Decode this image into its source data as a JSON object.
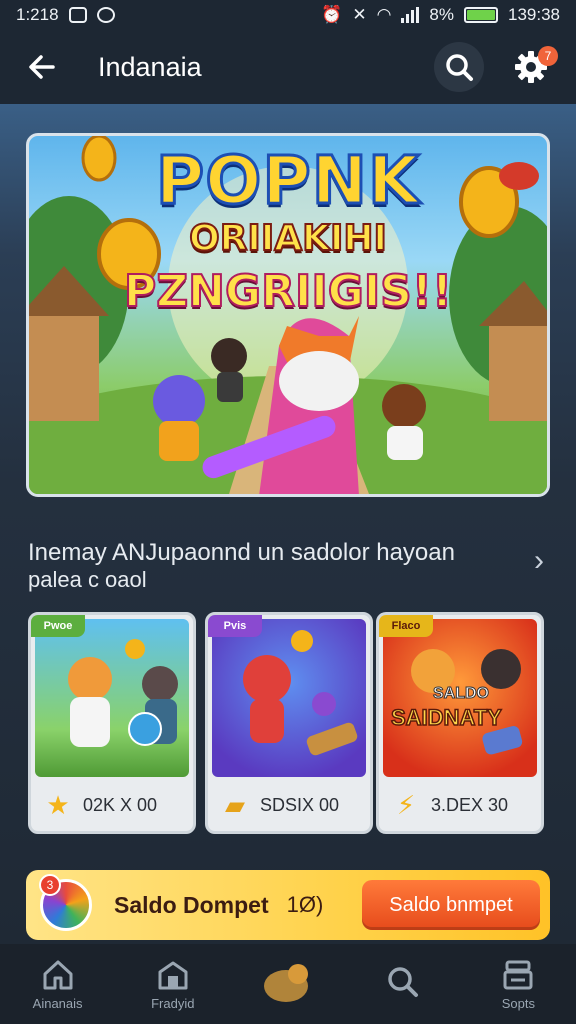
{
  "status_bar": {
    "time": "1:218",
    "right_time": "139:38",
    "battery": "8%"
  },
  "header": {
    "title": "Indanaia",
    "back_icon": "arrow-left-icon",
    "search_icon": "search-icon",
    "settings_icon": "gear-icon",
    "badge": "7"
  },
  "hero": {
    "title_line1": "POPNK",
    "title_line2": "ORIIAKIHI",
    "title_line3": "PZNGRIIGIS!!"
  },
  "section": {
    "title": "Inemay ANJupaonnd un sadolor hayoan",
    "subtitle": "palea c oaol"
  },
  "cards": [
    {
      "tag": "Pwoe",
      "icon": "star-icon",
      "value": "02K X   00"
    },
    {
      "tag": "Pvis",
      "icon": "chest-icon",
      "value": "SDSIX   00"
    },
    {
      "tag": "Flaco",
      "icon": "lightning-icon",
      "value": "3.DEX   30",
      "art_text_1": "SALDO",
      "art_text_2": "SAIDNATY"
    }
  ],
  "wallet": {
    "badge": "3",
    "label": "Saldo Dompet",
    "value": "1Ø)",
    "button": "Saldo bnmpet"
  },
  "bottom_nav": [
    {
      "icon": "home-icon",
      "label": "Ainanais"
    },
    {
      "icon": "store-icon",
      "label": "Fradyid"
    },
    {
      "icon": "ball-icon",
      "label": ""
    },
    {
      "icon": "search-icon",
      "label": ""
    },
    {
      "icon": "inbox-icon",
      "label": "Sopts"
    }
  ],
  "colors": {
    "background": "#1d2733",
    "accent_orange": "#e64a1b",
    "wallet_yellow": "#ffd24a",
    "battery_green": "#6fd24a"
  }
}
